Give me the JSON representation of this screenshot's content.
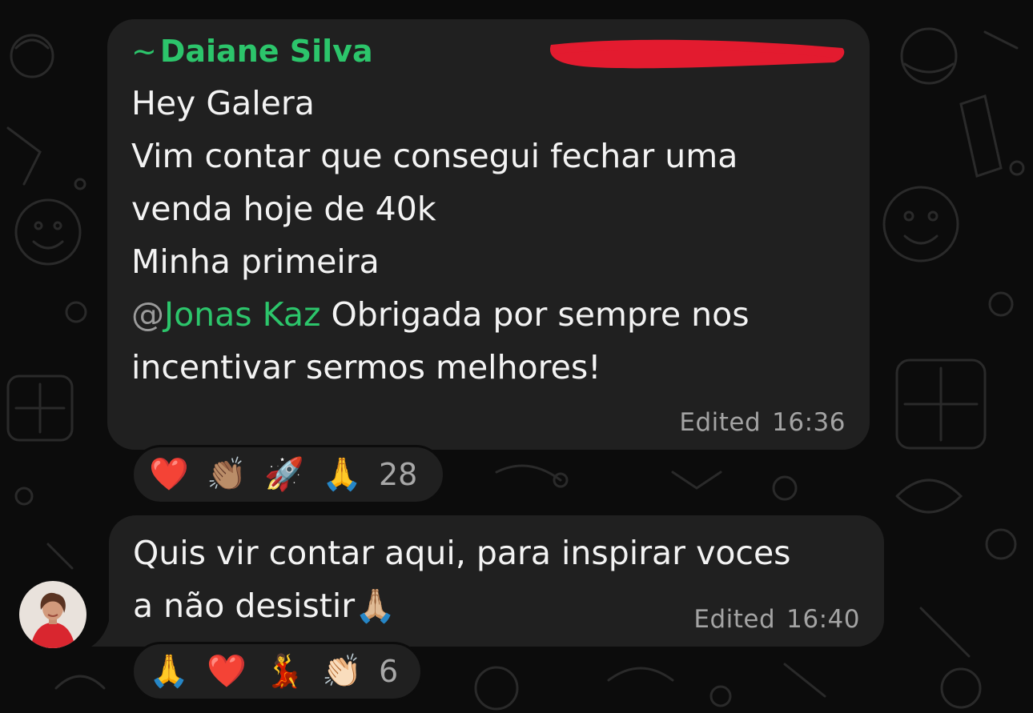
{
  "messages": [
    {
      "sender_prefix": "~",
      "sender": "Daiane Silva",
      "lines": [
        "Hey Galera",
        "Vim contar que consegui fechar uma",
        "venda hoje de 40k",
        "Minha primeira"
      ],
      "mention_at": "@",
      "mention_name": "Jonas Kaz",
      "mention_rest": " Obrigada por sempre nos",
      "last_line": "incentivar sermos melhores!",
      "edited_label": "Edited",
      "time": "16:36",
      "reactions": [
        "❤️",
        "👏🏽",
        "🚀",
        "🙏"
      ],
      "reaction_count": "28"
    },
    {
      "lines": [
        "Quis vir contar aqui, para inspirar voces",
        "a não desistir🙏🏼"
      ],
      "edited_label": "Edited",
      "time": "16:40",
      "reactions": [
        "🙏",
        "❤️",
        "💃",
        "👏🏻"
      ],
      "reaction_count": "6"
    }
  ],
  "colors": {
    "background": "#0c0c0c",
    "bubble": "#202020",
    "accent_green": "#2cc56b",
    "redaction_red": "#e31b2f",
    "meta_gray": "#a3a3a3"
  },
  "icons": {
    "avatar": "user-avatar",
    "redaction": "red-scribble-redaction"
  }
}
